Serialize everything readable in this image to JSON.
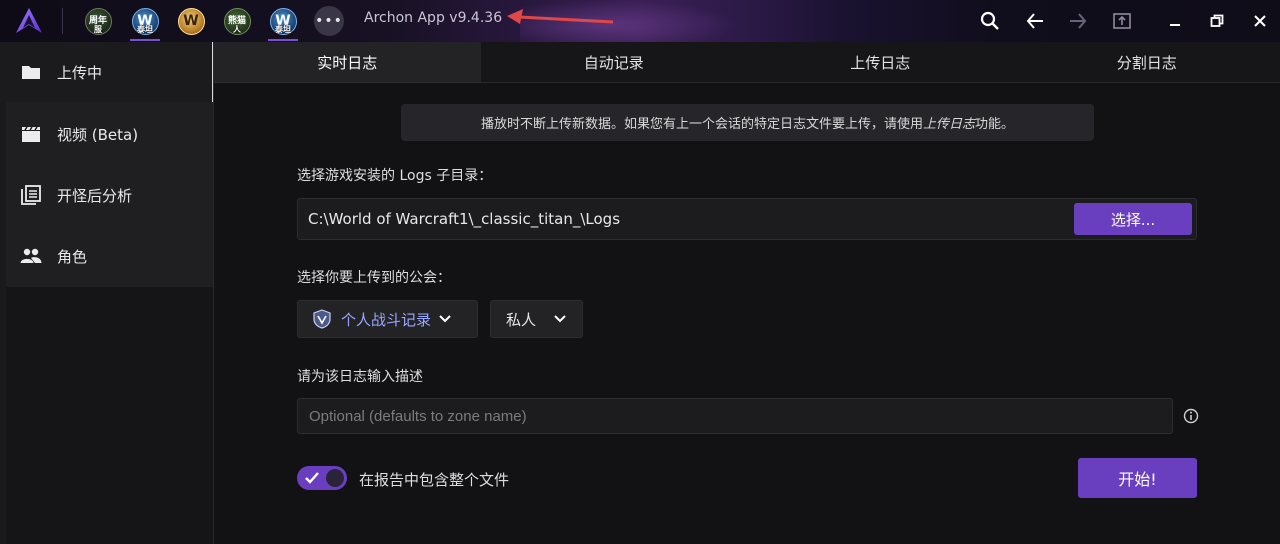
{
  "titlebar": {
    "app_title": "Archon App v9.4.36",
    "games": [
      {
        "label": "周年",
        "sub": "服"
      },
      {
        "label": "W",
        "sub": "泰坦"
      },
      {
        "label": "W",
        "sub": ""
      },
      {
        "label": "熊猫",
        "sub": "人"
      },
      {
        "label": "W",
        "sub": "泰坦"
      }
    ],
    "more_label": "•••"
  },
  "sidebar": {
    "items": [
      {
        "label": "上传中",
        "icon": "folder-icon"
      },
      {
        "label": "视频 (Beta)",
        "icon": "clapperboard-icon"
      },
      {
        "label": "开怪后分析",
        "icon": "book-list-icon"
      },
      {
        "label": "角色",
        "icon": "people-icon"
      }
    ]
  },
  "tabs": [
    {
      "label": "实时日志",
      "active": true
    },
    {
      "label": "自动记录",
      "active": false
    },
    {
      "label": "上传日志",
      "active": false
    },
    {
      "label": "分割日志",
      "active": false
    }
  ],
  "main": {
    "info_text_before": "播放时不断上传新数据。如果您有上一个会话的特定日志文件要上传，请使用",
    "info_text_italic": "上传日志",
    "info_text_after": "功能。",
    "dir_label": "选择游戏安装的 Logs 子目录：",
    "dir_value": "C:\\World of Warcraft1\\_classic_titan_\\Logs",
    "choose_button": "选择...",
    "guild_label": "选择你要上传到的公会：",
    "guild_value": "个人战斗记录",
    "privacy_value": "私人",
    "desc_label": "请为该日志输入描述",
    "desc_placeholder": "Optional (defaults to zone name)",
    "include_file_label": "在报告中包含整个文件",
    "include_file_checked": true,
    "start_button": "开始!"
  },
  "colors": {
    "accent": "#6a3fbf",
    "guild_text": "#9aa8ff"
  }
}
